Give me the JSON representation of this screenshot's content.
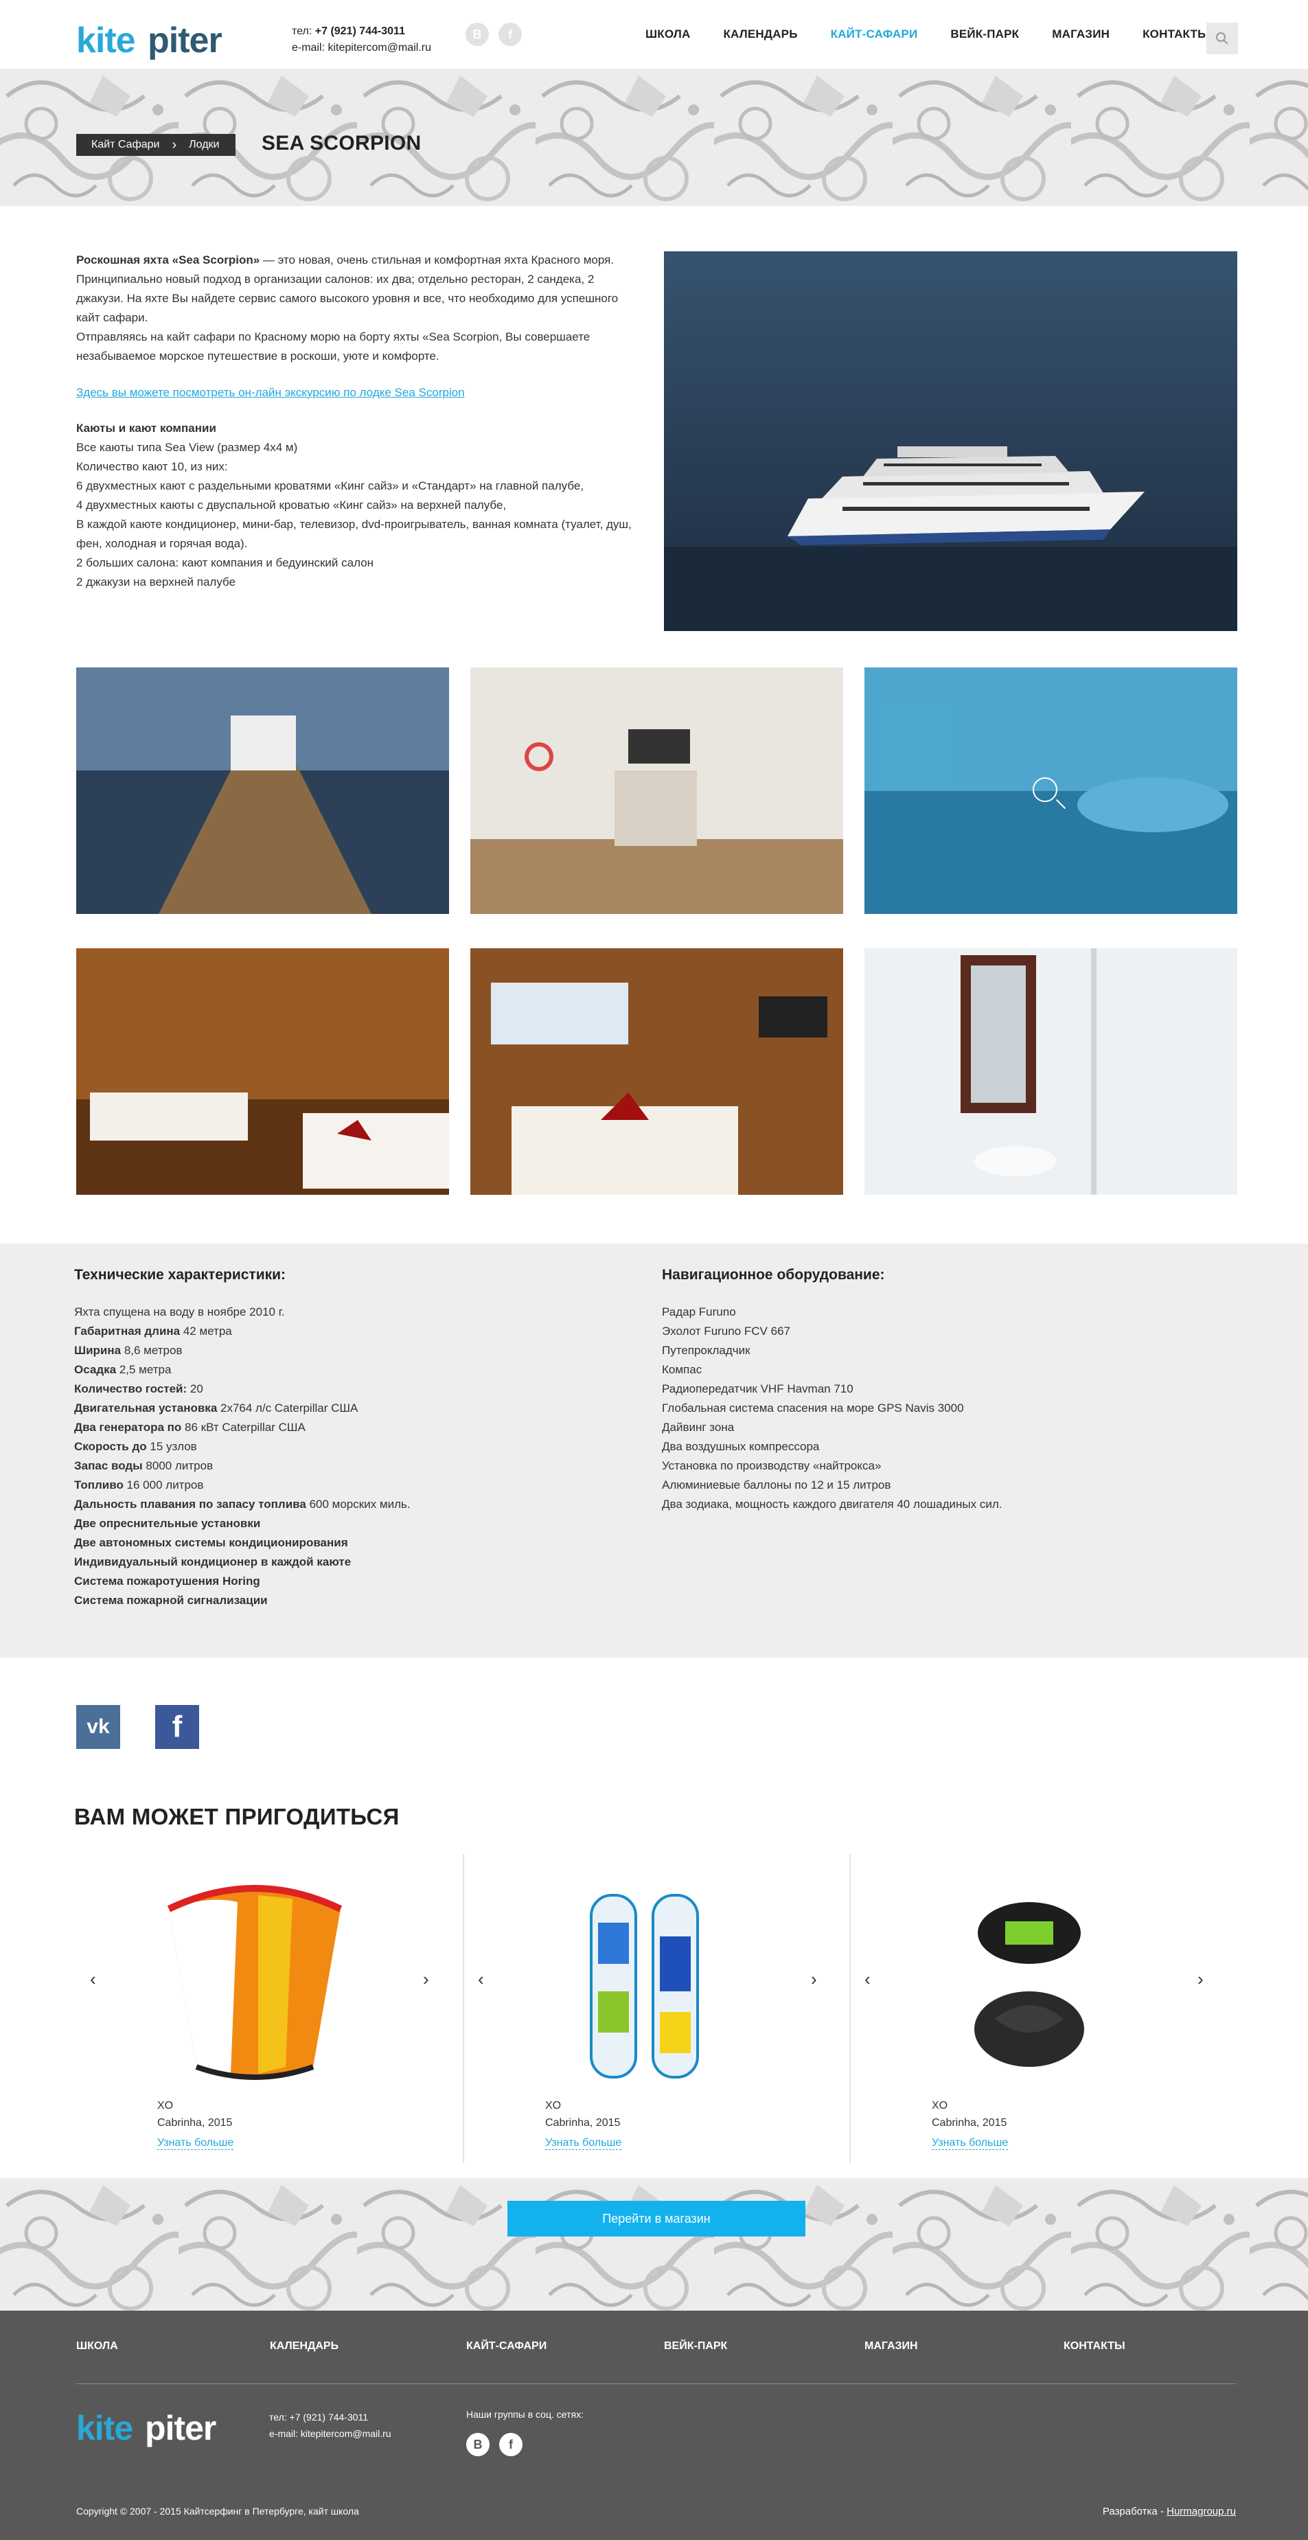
{
  "header": {
    "logo_text": "kitepiter",
    "phone_label": "тел:",
    "phone": "+7 (921) 744-3011",
    "email_label": "e-mail:",
    "email": "kitepitercom@mail.ru",
    "social": [
      "В",
      "f"
    ],
    "nav": [
      {
        "label": "ШКОЛА",
        "active": false
      },
      {
        "label": "КАЛЕНДАРЬ",
        "active": false
      },
      {
        "label": "КАЙТ-САФАРИ",
        "active": true
      },
      {
        "label": "ВЕЙК-ПАРК",
        "active": false
      },
      {
        "label": "МАГАЗИН",
        "active": false
      },
      {
        "label": "КОНТАКТЫ",
        "active": false
      }
    ],
    "accent_color": "#1fa8dc"
  },
  "hero": {
    "breadcrumbs": [
      "Кайт Сафари",
      "Лодки"
    ],
    "title": "SEA SCORPION"
  },
  "intro": {
    "p1_bold": "Роскошная яхта «Sea Scorpion»",
    "p1": " — это новая, очень стильная и комфортная яхта Красного моря. Принципиально новый подход в организации салонов: их два; отдельно ресторан, 2 сандека, 2 джакузи. На яхте Вы найдете сервис самого высокого уровня и все, что необходимо для успешного кайт сафари.",
    "p2": "Отправляясь на кайт сафари по Красному морю на борту яхты «Sea Scorpion, Вы совершаете незабываемое морское путешествие в роскоши, уюте и комфорте.",
    "link": "Здесь вы можете посмотреть он-лайн экскурсию по лодке Sea Scorpion",
    "cabins_title": "Каюты и кают компании",
    "cabins": [
      "Все каюты типа Sea View (размер 4х4 м)",
      "Количество кают 10, из них:",
      "6 двухместных кают с раздельными кроватями «Кинг сайз» и «Стандарт» на главной палубе,",
      "4 двухместных каюты с двуспальной кроватью «Кинг сайз» на верхней палубе,",
      "В каждой каюте кондиционер, мини-бар, телевизор, dvd-проигрыватель, ванная комната (туалет, душ, фен, холодная и горячая вода).",
      "2 больших салона: кают компания и бедуинский салон",
      "2 джакузи на верхней палубе"
    ]
  },
  "specs": {
    "left_title": "Технические характеристики:",
    "left": [
      {
        "b": "",
        "t": "Яхта спущена на воду в ноябре 2010 г."
      },
      {
        "b": "Габаритная длина",
        "t": " 42 метра"
      },
      {
        "b": "Ширина",
        "t": " 8,6 метров"
      },
      {
        "b": "Осадка",
        "t": " 2,5 метра"
      },
      {
        "b": "Количество гостей:",
        "t": " 20"
      },
      {
        "b": "Двигательная установка",
        "t": " 2х764 л/с Caterpillar США"
      },
      {
        "b": "Два генератора по",
        "t": " 86 кВт Caterpillar США"
      },
      {
        "b": "Скорость до",
        "t": " 15 узлов"
      },
      {
        "b": "Запас воды",
        "t": " 8000 литров"
      },
      {
        "b": "Топливо",
        "t": " 16 000 литров"
      },
      {
        "b": "Дальность плавания по запасу топлива",
        "t": " 600 морских миль."
      },
      {
        "b": "Две опреснительные установки",
        "t": ""
      },
      {
        "b": "Две автономных системы кондиционирования",
        "t": ""
      },
      {
        "b": "Индивидуальный кондиционер в каждой каюте",
        "t": ""
      },
      {
        "b": "Система пожаротушения Horing",
        "t": ""
      },
      {
        "b": "Система пожарной сигнализации",
        "t": ""
      }
    ],
    "right_title": "Навигационное оборудование:",
    "right": [
      "Радар Furuno",
      "Эхолот Furuno FCV 667",
      "Путепрокладчик",
      "Компас",
      "Радиопередатчик VHF Havman 710",
      "Глобальная система спасения на море GPS Navis 3000",
      "Дайвинг зона",
      "Два воздушных компрессора",
      "Установка по производству «найтрокса»",
      "Алюминиевые баллоны по 12 и 15 литров",
      "Два зодиака, мощность каждого двигателя 40 лошадиных сил."
    ]
  },
  "share": {
    "vk": "vk",
    "fb": "f"
  },
  "related": {
    "title": "ВАМ МОЖЕТ ПРИГОДИТЬСЯ",
    "products": [
      {
        "name": "XO",
        "sub": "Cabrinha, 2015",
        "link": "Узнать больше",
        "icon": "kite-icon"
      },
      {
        "name": "XO",
        "sub": "Cabrinha, 2015",
        "link": "Узнать больше",
        "icon": "kiteboard-icon"
      },
      {
        "name": "XO",
        "sub": "Cabrinha, 2015",
        "link": "Узнать больше",
        "icon": "harness-icon"
      }
    ],
    "arrows": {
      "prev": "‹",
      "next": "›"
    },
    "shop_button": "Перейти в магазин"
  },
  "footer": {
    "nav": [
      "ШКОЛА",
      "КАЛЕНДАРЬ",
      "КАЙТ-САФАРИ",
      "ВЕЙК-ПАРК",
      "МАГАЗИН",
      "КОНТАКТЫ"
    ],
    "phone": "тел: +7 (921) 744-3011",
    "email": "e-mail: kitepitercom@mail.ru",
    "groups_label": "Наши группы в соц. сетях:",
    "social": [
      "В",
      "f"
    ],
    "copyright": "Copyright © 2007 - 2015 Кайтсерфинг в Петербурге, кайт школа",
    "dev_label": "Разработка - ",
    "dev_link": "Hurmagroup.ru"
  }
}
